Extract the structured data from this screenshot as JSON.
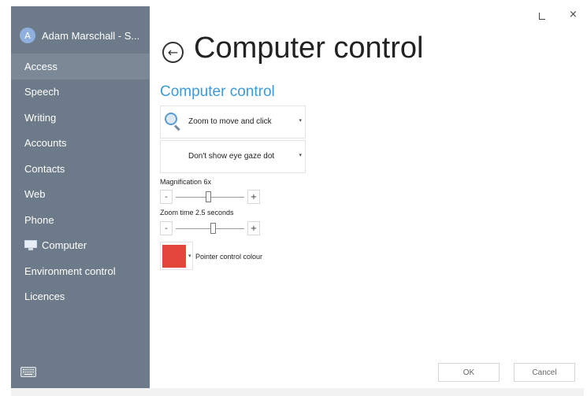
{
  "user": {
    "initial": "A",
    "name": "Adam Marschall - S..."
  },
  "sidebar": {
    "items": [
      {
        "label": "Access"
      },
      {
        "label": "Speech"
      },
      {
        "label": "Writing"
      },
      {
        "label": "Accounts"
      },
      {
        "label": "Contacts"
      },
      {
        "label": "Web"
      },
      {
        "label": "Phone"
      },
      {
        "label": "Computer",
        "icon": "computer-icon"
      },
      {
        "label": "Environment control"
      },
      {
        "label": "Licences"
      }
    ],
    "active": "Access",
    "keyboard_icon": "keyboard-icon"
  },
  "window_controls": {
    "minimize_glyph": "",
    "close_glyph": "×"
  },
  "header": {
    "back_glyph": "←",
    "title": "Computer control"
  },
  "main": {
    "section_title": "Computer control",
    "mode_dropdown": {
      "value": "Zoom to move and click",
      "arrow": "▾",
      "icon": "magnifier-icon"
    },
    "gaze_dropdown": {
      "value": "Don't show eye gaze dot",
      "arrow": "▾"
    },
    "magnification": {
      "label": "Magnification 6x",
      "minus": "-",
      "plus": "+",
      "level_fraction": 0.48
    },
    "zoom_time": {
      "label": "Zoom time 2.5 seconds",
      "minus": "-",
      "plus": "+",
      "level_fraction": 0.55
    },
    "pointer_colour": {
      "label": "Pointer control colour",
      "arrow": "▾",
      "color": "#e3463a"
    }
  },
  "buttons": {
    "ok": "OK",
    "cancel": "Cancel"
  },
  "colors": {
    "sidebar": "#6c7a89",
    "sidebar_active": "#7b8997",
    "accent": "#3b9bd9"
  }
}
